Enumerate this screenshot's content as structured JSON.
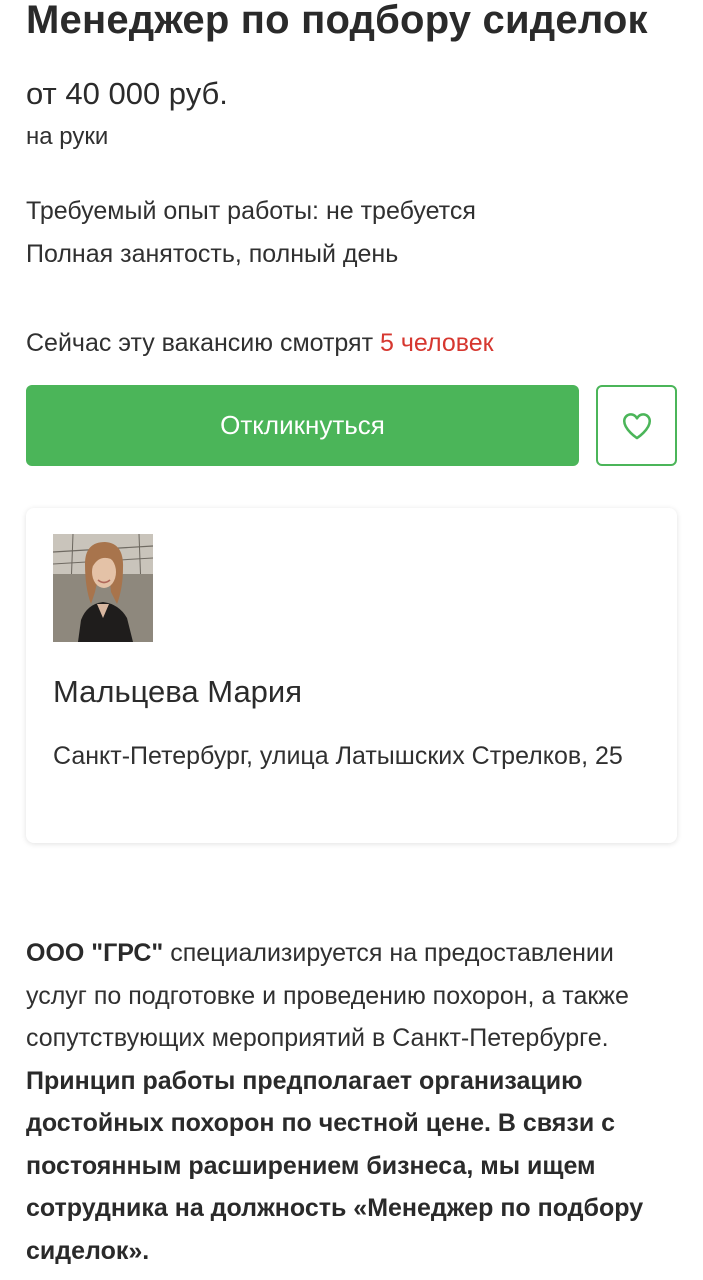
{
  "vacancy": {
    "title": "Менеджер по подбору сиделок",
    "salary": "от 40 000 руб.",
    "salary_note": "на руки",
    "experience": "Требуемый опыт работы: не требуется",
    "employment": "Полная занятость, полный день"
  },
  "viewers": {
    "prefix": "Сейчас эту вакансию смотрят ",
    "count": "5 человек",
    "count_color": "#d6372f"
  },
  "actions": {
    "apply_label": "Откликнуться",
    "favorite_icon": "heart-icon",
    "accent_color": "#4bb559"
  },
  "contact": {
    "name": "Мальцева Мария",
    "address": "Санкт-Петербург, улица Латышских Стрелков, 25",
    "avatar": "contact-photo"
  },
  "description": {
    "company": "ООО \"ГРС\"",
    "text1": " специализируется на предоставлении услуг по подготовке и проведению похорон, а также сопутствующих мероприятий в Санкт-Петербурге. ",
    "bold_text": "Принцип работы предполагает организацию достойных похорон по честной цене. В связи с постоянным расширением бизнеса, мы ищем сотрудника на должность «Менеджер по подбору сиделок»."
  }
}
